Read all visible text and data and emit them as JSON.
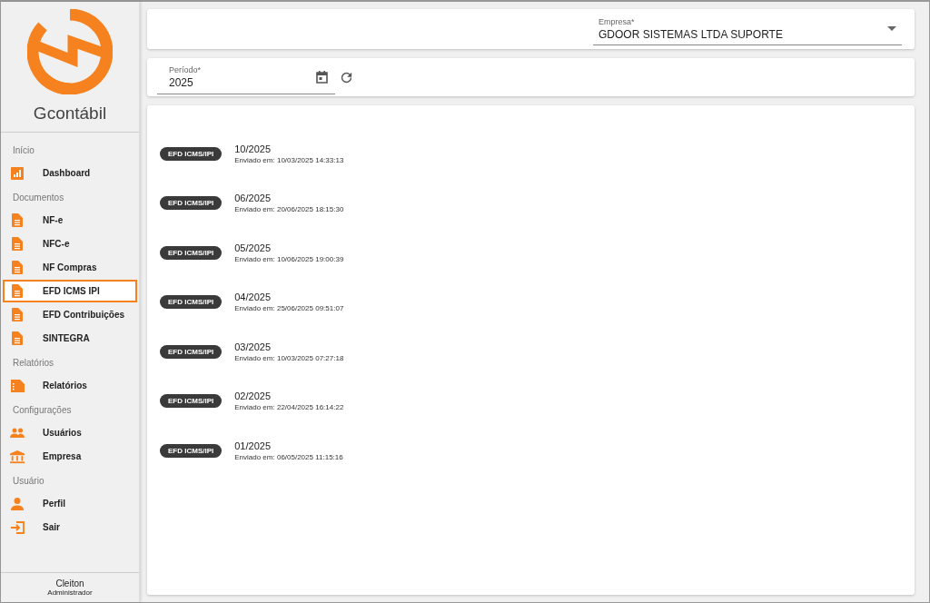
{
  "brand": {
    "name": "Gcontábil"
  },
  "sidebar": {
    "sections": [
      {
        "title": "Início",
        "items": [
          {
            "label": "Dashboard",
            "kind": "chart",
            "selected": false
          }
        ]
      },
      {
        "title": "Documentos",
        "items": [
          {
            "label": "NF-e",
            "kind": "doc",
            "selected": false
          },
          {
            "label": "NFC-e",
            "kind": "doc",
            "selected": false
          },
          {
            "label": "NF Compras",
            "kind": "doc",
            "selected": false
          },
          {
            "label": "EFD ICMS IPI",
            "kind": "doc",
            "selected": true
          },
          {
            "label": "EFD Contribuições",
            "kind": "doc",
            "selected": false
          },
          {
            "label": "SINTEGRA",
            "kind": "doc",
            "selected": false
          }
        ]
      },
      {
        "title": "Relatórios",
        "items": [
          {
            "label": "Relatórios",
            "kind": "report",
            "selected": false
          }
        ]
      },
      {
        "title": "Configurações",
        "items": [
          {
            "label": "Usuários",
            "kind": "users",
            "selected": false
          },
          {
            "label": "Empresa",
            "kind": "bank",
            "selected": false
          }
        ]
      },
      {
        "title": "Usuário",
        "items": [
          {
            "label": "Perfil",
            "kind": "person",
            "selected": false
          },
          {
            "label": "Sair",
            "kind": "exit",
            "selected": false
          }
        ]
      }
    ],
    "user": {
      "name": "Cleiton",
      "role": "Administrador"
    }
  },
  "company_select": {
    "label": "Empresa*",
    "value": "GDOOR SISTEMAS LTDA SUPORTE"
  },
  "period_field": {
    "label": "Período*",
    "value": "2025"
  },
  "submissions": [
    {
      "tag": "EFD ICMS/IPI",
      "period": "10/2025",
      "sent": "Enviado em: 10/03/2025 14:33:13"
    },
    {
      "tag": "EFD ICMS/IPI",
      "period": "06/2025",
      "sent": "Enviado em: 20/06/2025 18:15:30"
    },
    {
      "tag": "EFD ICMS/IPI",
      "period": "05/2025",
      "sent": "Enviado em: 10/06/2025 19:00:39"
    },
    {
      "tag": "EFD ICMS/IPI",
      "period": "04/2025",
      "sent": "Enviado em: 25/06/2025 09:51:07"
    },
    {
      "tag": "EFD ICMS/IPI",
      "period": "03/2025",
      "sent": "Enviado em: 10/03/2025 07:27:18"
    },
    {
      "tag": "EFD ICMS/IPI",
      "period": "02/2025",
      "sent": "Enviado em: 22/04/2025 16:14:22"
    },
    {
      "tag": "EFD ICMS/IPI",
      "period": "01/2025",
      "sent": "Enviado em: 06/05/2025 11:15:16"
    }
  ]
}
